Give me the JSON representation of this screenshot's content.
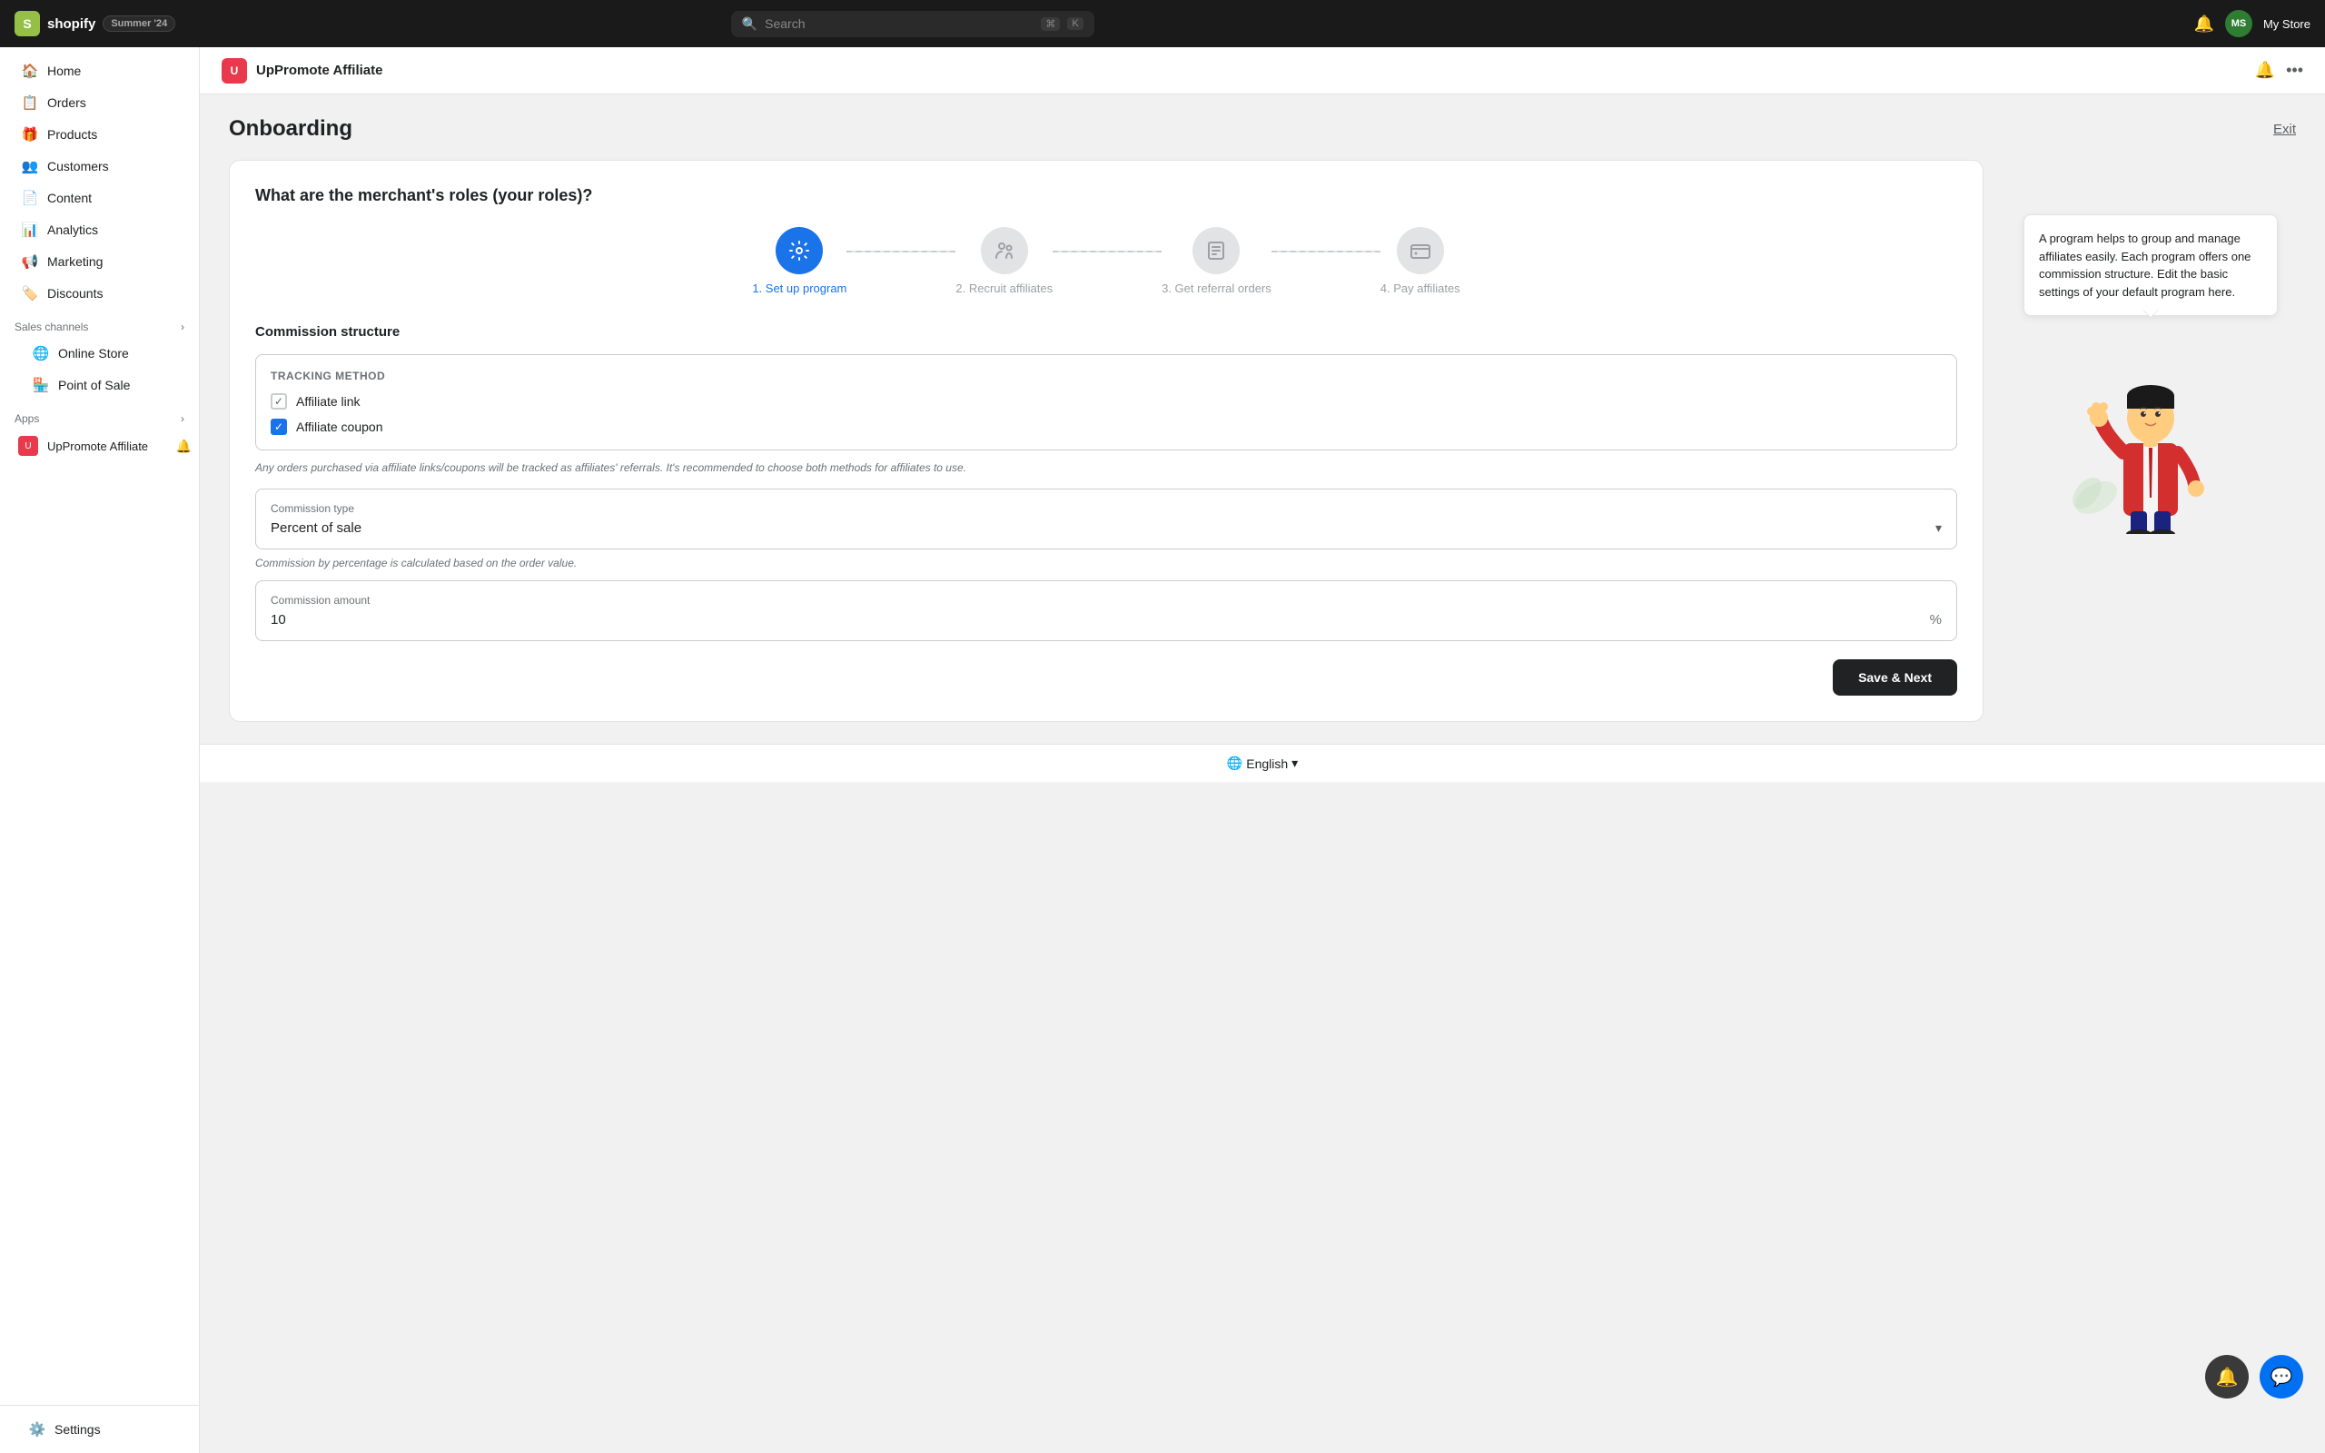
{
  "topbar": {
    "logo_letter": "S",
    "brand": "shopify",
    "badge": "Summer '24",
    "search_placeholder": "Search",
    "kbd1": "⌘",
    "kbd2": "K",
    "avatar_initials": "MS",
    "store_name": "My Store"
  },
  "sidebar": {
    "nav_items": [
      {
        "id": "home",
        "label": "Home",
        "icon": "🏠"
      },
      {
        "id": "orders",
        "label": "Orders",
        "icon": "📋"
      },
      {
        "id": "products",
        "label": "Products",
        "icon": "🎁"
      },
      {
        "id": "customers",
        "label": "Customers",
        "icon": "👥"
      },
      {
        "id": "content",
        "label": "Content",
        "icon": "📄"
      },
      {
        "id": "analytics",
        "label": "Analytics",
        "icon": "📊"
      },
      {
        "id": "marketing",
        "label": "Marketing",
        "icon": "📢"
      },
      {
        "id": "discounts",
        "label": "Discounts",
        "icon": "🏷️"
      }
    ],
    "sales_channels_label": "Sales channels",
    "sales_channels": [
      {
        "id": "online-store",
        "label": "Online Store",
        "icon": "🌐"
      },
      {
        "id": "point-of-sale",
        "label": "Point of Sale",
        "icon": "🏪"
      }
    ],
    "apps_label": "Apps",
    "apps": [
      {
        "id": "uppromote",
        "label": "UpPromote Affiliate",
        "icon": "U"
      }
    ],
    "settings_label": "Settings",
    "settings_icon": "⚙️"
  },
  "app_header": {
    "logo_letter": "U",
    "title": "UpPromote Affiliate",
    "bell_label": "notifications",
    "more_label": "more options"
  },
  "page": {
    "title": "Onboarding",
    "exit_label": "Exit"
  },
  "steps": [
    {
      "number": "1",
      "label": "1. Set up program",
      "icon": "⚙️",
      "active": true
    },
    {
      "number": "2",
      "label": "2. Recruit affiliates",
      "icon": "👥",
      "active": false
    },
    {
      "number": "3",
      "label": "3. Get referral orders",
      "icon": "📄",
      "active": false
    },
    {
      "number": "4",
      "label": "4. Pay affiliates",
      "icon": "💳",
      "active": false
    }
  ],
  "form": {
    "question": "What are the merchant's roles (your roles)?",
    "commission_structure_title": "Commission structure",
    "tracking_method_title": "Tracking method",
    "affiliate_link_label": "Affiliate link",
    "affiliate_link_checked": false,
    "affiliate_coupon_label": "Affiliate coupon",
    "affiliate_coupon_checked": true,
    "tracking_hint": "Any orders purchased via affiliate links/coupons will be tracked as affiliates' referrals. It's recommended to choose both methods for affiliates to use.",
    "commission_type_label": "Commission type",
    "commission_type_value": "Percent of sale",
    "commission_type_hint": "Commission by percentage is calculated based on the order value.",
    "commission_amount_label": "Commission amount",
    "commission_amount_value": "10",
    "commission_amount_suffix": "%",
    "save_next_label": "Save & Next"
  },
  "info_box": {
    "text": "A program helps to group and manage affiliates easily. Each program offers one commission structure. Edit the basic settings of your default program here."
  },
  "footer": {
    "globe_icon": "🌐",
    "language_label": "English",
    "chevron": "▾"
  },
  "fabs": {
    "notif_icon": "🔔",
    "chat_icon": "💬"
  }
}
